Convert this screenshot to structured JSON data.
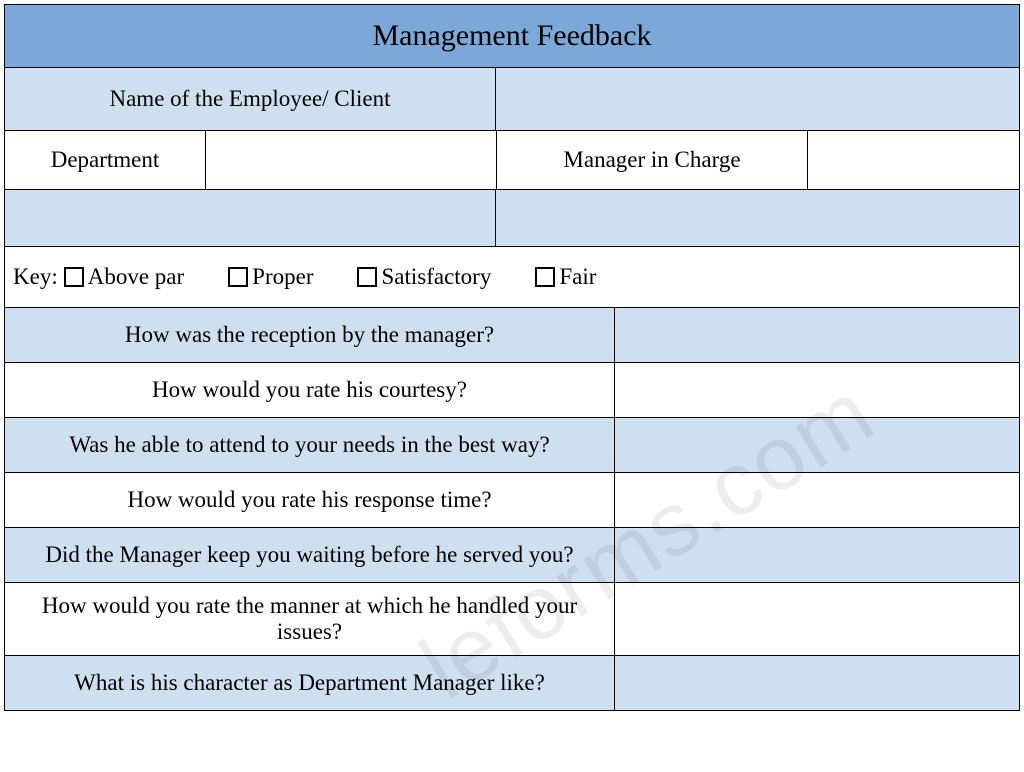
{
  "title": "Management Feedback",
  "fields": {
    "name_label": "Name of the Employee/ Client",
    "name_value": "",
    "department_label": "Department",
    "department_value": "",
    "manager_label": "Manager in Charge",
    "manager_value": ""
  },
  "key": {
    "label": "Key:",
    "options": [
      "Above par",
      "Proper",
      "Satisfactory",
      "Fair"
    ]
  },
  "questions": [
    "How was the reception by the manager?",
    "How would you rate his courtesy?",
    "Was he able to attend to your needs in the best way?",
    "How would you rate his response time?",
    "Did the Manager keep you waiting before he served you?",
    "How would you rate the manner at which he handled your issues?",
    "What is his character as Department Manager like?"
  ],
  "watermark": "leforms.com",
  "colors": {
    "header": "#7ba7d9",
    "alt_row": "#cedff0",
    "border": "#000000"
  }
}
